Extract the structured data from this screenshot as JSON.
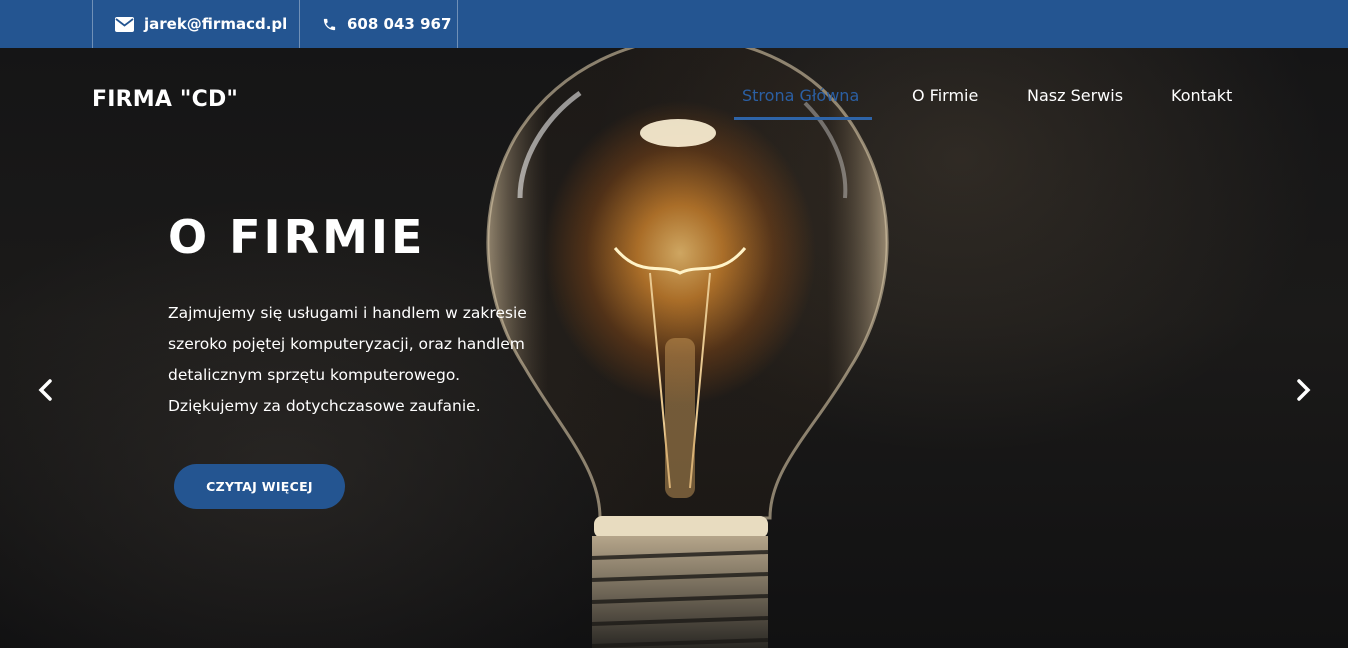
{
  "topbar": {
    "email": "jarek@firmacd.pl",
    "phone": "608 043 967"
  },
  "header": {
    "logo": "FIRMA \"CD\"",
    "nav": [
      {
        "label": "Strona Główna",
        "active": true
      },
      {
        "label": "O Firmie"
      },
      {
        "label": "Nasz Serwis"
      },
      {
        "label": "Kontakt"
      }
    ]
  },
  "hero": {
    "title": "O FIRMIE",
    "description_lines": [
      "Zajmujemy się usługami i handlem w zakresie",
      "szeroko pojętej komputeryzacji, oraz handlem",
      "detalicznym sprzętu komputerowego.",
      "Dziękujemy za dotychczasowe zaufanie."
    ],
    "cta_label": "CZYTAJ WIĘCEJ"
  },
  "colors": {
    "brand": "#245591",
    "active_nav": "#2b5fa3"
  },
  "icons": [
    "envelope-icon",
    "phone-icon",
    "chevron-left-icon",
    "chevron-right-icon"
  ]
}
